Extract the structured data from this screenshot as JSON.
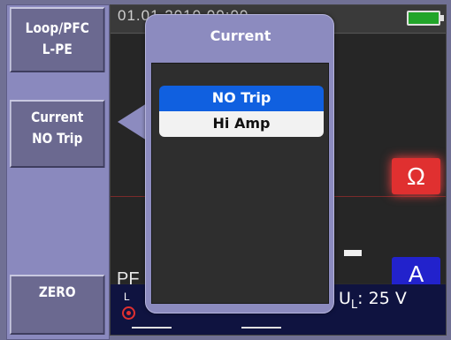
{
  "status_bar": {
    "datetime": "01.01.2010  00:00",
    "battery_icon": "battery-full-icon"
  },
  "softkeys": {
    "loop_line1": "Loop/PFC",
    "loop_line2": "L-PE",
    "current_line1": "Current",
    "current_line2": "NO Trip",
    "zero": "ZERO"
  },
  "measure": {
    "ohm_unit": "Ω",
    "amp_unit": "A",
    "pf_label": "PF",
    "l_label": "L",
    "ul_prefix": "U",
    "ul_sub": "L",
    "ul_value": ": 25 V"
  },
  "popup": {
    "title": "Current",
    "options": [
      {
        "label": "NO Trip",
        "selected": true
      },
      {
        "label": "Hi Amp",
        "selected": false
      }
    ]
  },
  "colors": {
    "selected_option": "#1060e0",
    "ohm_badge": "#e03030",
    "amp_badge": "#2222cc",
    "battery": "#22a52a"
  }
}
